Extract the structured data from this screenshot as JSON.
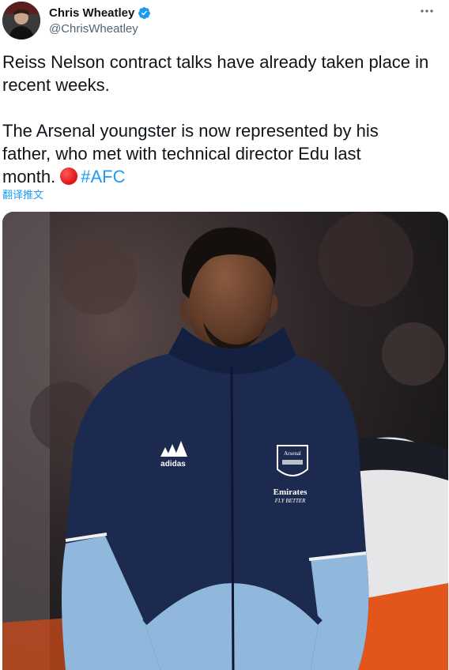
{
  "author": {
    "display_name": "Chris Wheatley",
    "handle": "@ChrisWheatley",
    "verified": true
  },
  "tweet": {
    "paragraph1": "Reiss Nelson contract talks have already taken place in recent weeks.",
    "paragraph2_line1": "The Arsenal youngster is now represented by his",
    "paragraph2_line2": "father, who met with technical director Edu last",
    "paragraph2_line3": "month.",
    "hashtag": "#AFC",
    "translate_link": "翻译推文"
  },
  "media": {
    "jacket_brand": "adidas",
    "crest_text": "Arsenal",
    "sponsor_line1": "Emirates",
    "sponsor_line2": "FLY BETTER"
  },
  "colors": {
    "link": "#1d9bf0",
    "verified": "#1d9bf0",
    "text": "#0f1419",
    "secondary": "#536471",
    "jacket_navy": "#1b2a4e",
    "jacket_light": "#8fb8dc"
  },
  "icons": {
    "verified": "verified-badge-icon",
    "more": "more-horizontal-icon",
    "red_circle": "red-circle-emoji-icon"
  }
}
